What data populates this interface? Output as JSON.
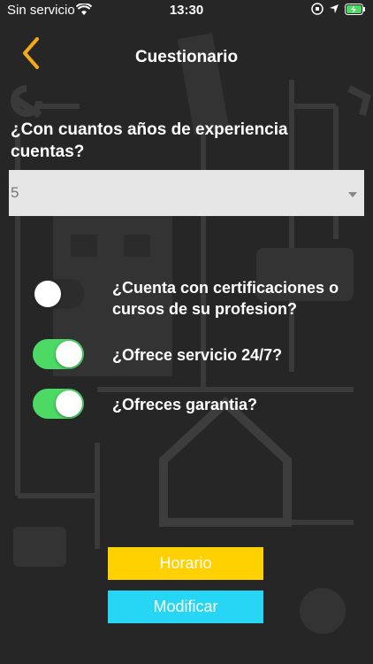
{
  "status_bar": {
    "carrier": "Sin servicio",
    "time": "13:30"
  },
  "header": {
    "title": "Cuestionario",
    "accent_color": "#f4a81a"
  },
  "question": {
    "text": "¿Con cuantos años de experiencia cuentas?"
  },
  "experience_select": {
    "value": "5"
  },
  "toggles": [
    {
      "label": "¿Cuenta con certificaciones o cursos de su profesion?",
      "on": false
    },
    {
      "label": "¿Ofrece servicio 24/7?",
      "on": true
    },
    {
      "label": "¿Ofreces garantia?",
      "on": true
    }
  ],
  "buttons": {
    "horario": "Horario",
    "modificar": "Modificar"
  },
  "colors": {
    "background": "#262626",
    "toggle_on": "#4cd964",
    "button_horario": "#ffd100",
    "button_modificar": "#26d6f4"
  }
}
